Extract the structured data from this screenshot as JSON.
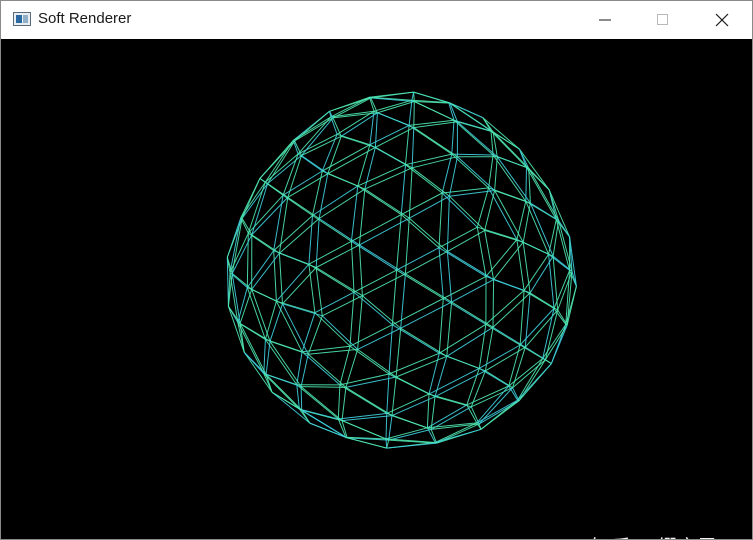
{
  "window": {
    "title": "Soft Renderer",
    "app_icon": "app-window-icon",
    "controls": {
      "minimize_icon": "minimize-icon",
      "maximize_icon": "maximize-icon",
      "close_icon": "close-icon"
    }
  },
  "viewport": {
    "background_color": "#000000",
    "wireframe_color": "#4fe8b0",
    "wireframe_alt_color": "#3fd2e0",
    "object": "wireframe-sphere-mesh"
  },
  "watermark": {
    "text": "知乎 @缪之灵"
  }
}
